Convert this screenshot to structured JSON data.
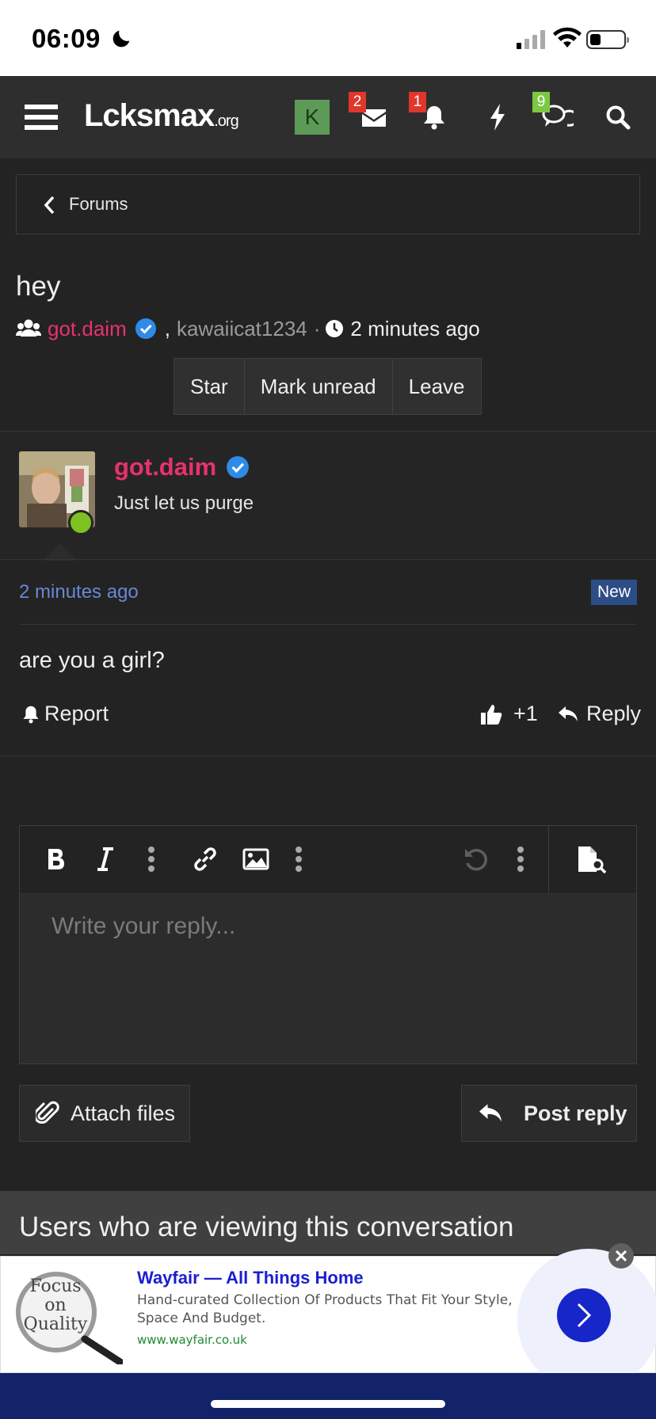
{
  "status_bar": {
    "time": "06:09"
  },
  "nav": {
    "logo_main": "Lcksmax",
    "logo_suffix": ".org",
    "avatar_letter": "K",
    "inbox_badge": "2",
    "alerts_badge": "1",
    "conversations_badge": "9"
  },
  "breadcrumb": {
    "label": "Forums"
  },
  "thread": {
    "title": "hey",
    "participant_1": "got.daim",
    "separator": ",",
    "participant_2": "kawaiicat1234",
    "dot": "·",
    "time": "2 minutes ago"
  },
  "thread_actions": {
    "star": "Star",
    "mark_unread": "Mark unread",
    "leave": "Leave"
  },
  "message": {
    "author": "got.daim",
    "user_title": "Just let us purge",
    "timestamp": "2 minutes ago",
    "new_badge": "New",
    "text": "are you a girl?",
    "report": "Report",
    "reaction_count": "+1",
    "reply": "Reply"
  },
  "editor": {
    "placeholder": "Write your reply..."
  },
  "buttons": {
    "attach": "Attach files",
    "post_reply": "Post reply"
  },
  "viewers": {
    "heading": "Users who are viewing this conversation"
  },
  "ad": {
    "image_text": "Focus on Quality",
    "title": "Wayfair — All Things Home",
    "description": "Hand-curated Collection Of Products That Fit Your Style, Space And Budget.",
    "url": "www.wayfair.co.uk"
  },
  "colors": {
    "accent_pink": "#e8326c",
    "link_blue": "#6a86d6",
    "badge_red": "#e0362c",
    "badge_green": "#7cc843",
    "ad_blue": "#1726c8"
  }
}
